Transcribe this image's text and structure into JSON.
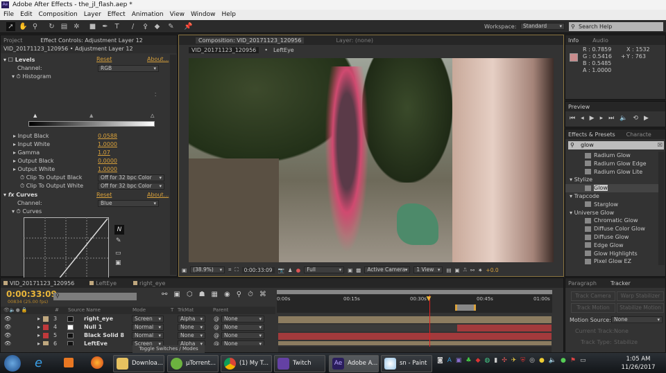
{
  "app": {
    "title": "Adobe After Effects - the_jl_flash.aep *",
    "logo": "Ae"
  },
  "menu": [
    "File",
    "Edit",
    "Composition",
    "Layer",
    "Effect",
    "Animation",
    "View",
    "Window",
    "Help"
  ],
  "workspace": {
    "label": "Workspace:",
    "value": "Standard"
  },
  "search_help": {
    "placeholder": "Search Help"
  },
  "effect_controls": {
    "tabs": [
      "Project",
      "Effect Controls: Adjustment Layer 12"
    ],
    "header": "VID_20171123_120956 • Adjustment Layer 12",
    "levels": {
      "name": "Levels",
      "reset": "Reset",
      "about": "About...",
      "channel_label": "Channel:",
      "channel": "RGB",
      "histogram": "Histogram",
      "props": [
        {
          "label": "Input Black",
          "value": "0.0588"
        },
        {
          "label": "Input White",
          "value": "1.0000"
        },
        {
          "label": "Gamma",
          "value": "1.07"
        },
        {
          "label": "Output Black",
          "value": "0.0000"
        },
        {
          "label": "Output White",
          "value": "1.0000"
        }
      ],
      "clip_black_label": "Clip To Output Black",
      "clip_black": "Off for 32 bpc Color",
      "clip_white_label": "Clip To Output White",
      "clip_white": "Off for 32 bpc Color"
    },
    "curves": {
      "name": "Curves",
      "fx": "fx",
      "reset": "Reset",
      "about": "About...",
      "channel_label": "Channel:",
      "channel": "Blue",
      "graph": "Curves"
    }
  },
  "composition": {
    "tab": "Composition: VID_20171123_120956",
    "layer_tab": "Layer: (none)",
    "breadcrumbs": [
      "VID_20171123_120956",
      "LeftEye"
    ],
    "zoom": "(38.9%)",
    "timecode": "0:00:33:09",
    "resolution": "Full",
    "camera": "Active Camera",
    "view": "1 View",
    "exposure": "+0.0"
  },
  "info": {
    "tabs": [
      "Info",
      "Audio"
    ],
    "color": "#c98b8c",
    "r": "R : 0.7859",
    "g": "G : 0.5416",
    "b": "B : 0.5485",
    "a": "A : 1.0000",
    "x": "X : 1532",
    "y": "Y : 763"
  },
  "preview": {
    "tab": "Preview"
  },
  "effects_presets": {
    "tabs": [
      "Effects & Presets",
      "Characte"
    ],
    "search": "glow",
    "items": [
      {
        "type": "item",
        "label": "Radium Glow"
      },
      {
        "type": "item",
        "label": "Radium Glow Edge"
      },
      {
        "type": "item",
        "label": "Radium Glow Lite"
      },
      {
        "type": "cat",
        "label": "Stylize"
      },
      {
        "type": "item",
        "label": "Glow",
        "selected": true
      },
      {
        "type": "cat",
        "label": "Trapcode"
      },
      {
        "type": "item",
        "label": "Starglow"
      },
      {
        "type": "cat",
        "label": "Universe Glow"
      },
      {
        "type": "item",
        "label": "Chromatic Glow"
      },
      {
        "type": "item",
        "label": "Diffuse Color Glow"
      },
      {
        "type": "item",
        "label": "Diffuse Glow"
      },
      {
        "type": "item",
        "label": "Edge Glow"
      },
      {
        "type": "item",
        "label": "Glow Highlights"
      },
      {
        "type": "item",
        "label": "Pixel Glow EZ"
      }
    ]
  },
  "tracker": {
    "tabs": [
      "Paragraph",
      "Tracker"
    ],
    "track_camera": "Track Camera",
    "warp_stabilizer": "Warp Stabilizer",
    "track_motion": "Track Motion",
    "stabilize_motion": "Stabilize Motion",
    "motion_source_label": "Motion Source:",
    "motion_source": "None",
    "current_track_label": "Current Track:",
    "current_track": "None",
    "track_type_label": "Track Type:",
    "track_type": "Stabilize"
  },
  "timeline": {
    "tabs": [
      "VID_20171123_120956",
      "LeftEye",
      "right_eye"
    ],
    "timecode": "0:00:33:09",
    "frames": "00834 (25.00 fps)",
    "columns": {
      "num": "#",
      "source": "Source Name",
      "mode": "Mode",
      "t": "T",
      "trkmat": "TrkMat",
      "parent": "Parent"
    },
    "layers": [
      {
        "num": "3",
        "name": "right_eye",
        "mode": "Screen",
        "trkmat": "Alpha",
        "parent": "None",
        "color": "#bfa77e"
      },
      {
        "num": "4",
        "name": "Null 1",
        "mode": "Normal",
        "trkmat": "None",
        "parent": "None",
        "color": "#c0393b"
      },
      {
        "num": "5",
        "name": "Black Solid 8",
        "mode": "Normal",
        "trkmat": "None",
        "parent": "None",
        "color": "#c0393b"
      },
      {
        "num": "6",
        "name": "LeftEye",
        "mode": "Screen",
        "trkmat": "Alpha",
        "parent": "None",
        "color": "#bfa77e"
      }
    ],
    "toggle": "Toggle Switches / Modes",
    "ruler": [
      "0:00s",
      "00:15s",
      "00:30s",
      "00:45s",
      "01:00s"
    ],
    "playhead_fraction": 0.553
  },
  "taskbar": {
    "items": [
      "Downloa...",
      "µTorrent...",
      "(1) My T...",
      "Twitch",
      "Adobe A...",
      "sn - Paint"
    ],
    "time": "1:05 AM",
    "date": "11/26/2017"
  }
}
